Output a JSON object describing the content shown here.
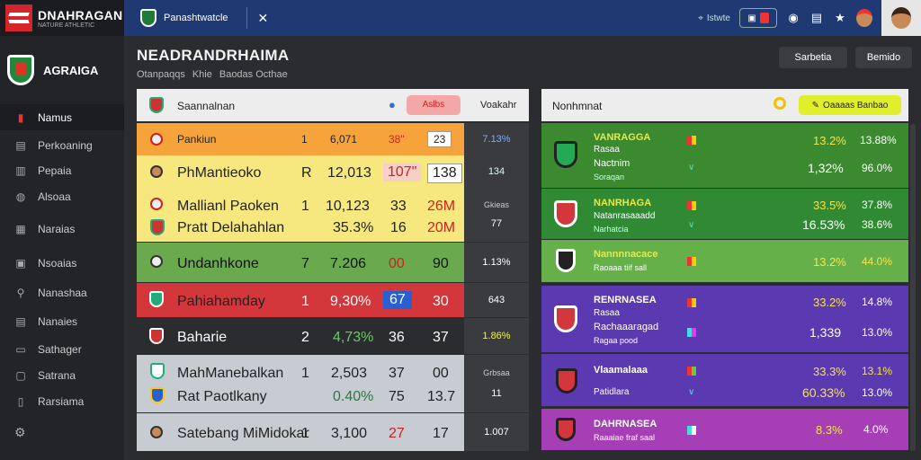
{
  "topbar": {
    "brand_name": "DNAHRAGAN",
    "brand_sub": "NATURE ATHLETIC",
    "league_name": "Panashtwatcle",
    "search_label": "Istwte",
    "avatar_label": "user avatar"
  },
  "sidebar": {
    "club_name": "AGRAIGA",
    "items": [
      {
        "label": "Namus",
        "icon": "shield-icon"
      },
      {
        "label": "Perkoaning",
        "icon": "list-icon"
      },
      {
        "label": "Pepaia",
        "icon": "chart-icon"
      },
      {
        "label": "Alsoaa",
        "icon": "user-icon"
      },
      {
        "label": "Naraias",
        "icon": "grid-icon"
      },
      {
        "label": "Nsoaias",
        "icon": "calendar-icon"
      },
      {
        "label": "Nanashaa",
        "icon": "search-icon"
      },
      {
        "label": "Nanaies",
        "icon": "table-icon"
      },
      {
        "label": "Sathager",
        "icon": "filter-icon"
      },
      {
        "label": "Satrana",
        "icon": "folder-icon"
      },
      {
        "label": "Rarsiama",
        "icon": "doc-icon"
      }
    ]
  },
  "header": {
    "title": "NEADRANDRHAIMA",
    "crumbs": [
      "Otanpaqqs",
      "Khie",
      "Baodas Octhae"
    ],
    "btn1": "Sarbetia",
    "btn2": "Bemido"
  },
  "left_panel": {
    "title": "Saannalnan",
    "chip": "Aslbs",
    "right_label": "Voakahr",
    "colors": {
      "orange": "#f5a33a",
      "yellow": "#f6e77e",
      "green": "#6aa94e",
      "red": "#d3363b",
      "dark": "#2b2c2f",
      "grey": "#c7ccd3"
    },
    "rows": [
      {
        "name": "Pankiun",
        "pos": "1",
        "v1": "6,071",
        "v2": "38\"",
        "v3": "23",
        "side": "7.13%"
      },
      {
        "name": "PhMantieoko",
        "pos": "R",
        "v1": "12,013",
        "v2": "107\"",
        "v3": "138",
        "side": "134"
      },
      {
        "name": "Mallianl Paoken",
        "pos": "1",
        "v1": "10,123",
        "v2": "33",
        "v3": "26M",
        "side": "Gkieas"
      },
      {
        "name": "Pratt Delahahlan",
        "pos": "",
        "v1": "35.3%",
        "v2": "16",
        "v3": "20M",
        "side": "77"
      },
      {
        "name": "Undanhkone",
        "pos": "7",
        "v1": "7.206",
        "v2": "00",
        "v3": "90",
        "side": "1.13%"
      },
      {
        "name": "Pahiahamday",
        "pos": "1",
        "v1": "9,30%",
        "v2": "67",
        "v3": "30",
        "side": "643"
      },
      {
        "name": "Baharie",
        "pos": "2",
        "v1": "4,73%",
        "v2": "36",
        "v3": "37",
        "side": "1.86%"
      },
      {
        "name": "MahManebalkan",
        "pos": "1",
        "v1": "2,503",
        "v2": "37",
        "v3": "00",
        "side": "Grbsaa"
      },
      {
        "name": "Rat Paotlkany",
        "pos": "",
        "v1": "0.40%",
        "v2": "75",
        "v3": "13.7",
        "side": "11"
      },
      {
        "name": "Satebang MiMidokar",
        "pos": "1",
        "v1": "3,100",
        "v2": "27",
        "v3": "17",
        "side": "1.007"
      }
    ]
  },
  "right_panel": {
    "title": "Nonhmnat",
    "button": "Oaaaas Banbao",
    "rows": [
      {
        "title": "VANRAGGA",
        "sub1": "Rasaa",
        "sub2": "Nactnim",
        "sub3": "Soraqan",
        "p1": "13.2%",
        "p2": "1,32%",
        "q1": "13.88%",
        "q2": "96.0%"
      },
      {
        "title": "NANRHAGA",
        "sub1": "Natanrasaaadd",
        "sub2": "Narhatcia",
        "p1": "33.5%",
        "p2": "16.53%",
        "q1": "37.8%",
        "q2": "38.6%"
      },
      {
        "title": "Nannnnacace",
        "sub1": "Raoaaa tiif sall",
        "p1": "13.2%",
        "q1": "44.0%"
      },
      {
        "title": "RENRNASEA",
        "sub1": "Rasaa",
        "sub2": "Rachaaaragad",
        "sub3": "Ragaa pood",
        "p1": "33.2%",
        "p2": "1,339",
        "q1": "14.8%",
        "q2": "13.0%"
      },
      {
        "title": "Vlaamalaaa",
        "sub1": "Patidlara",
        "p1": "33.3%",
        "p2": "60.33%",
        "q1": "13.1%",
        "q2": "13.0%"
      },
      {
        "title": "DAHRNASEA",
        "sub1": "Raaaiae fraf saal",
        "p1": "8.3%",
        "q1": "4.0%"
      }
    ]
  }
}
